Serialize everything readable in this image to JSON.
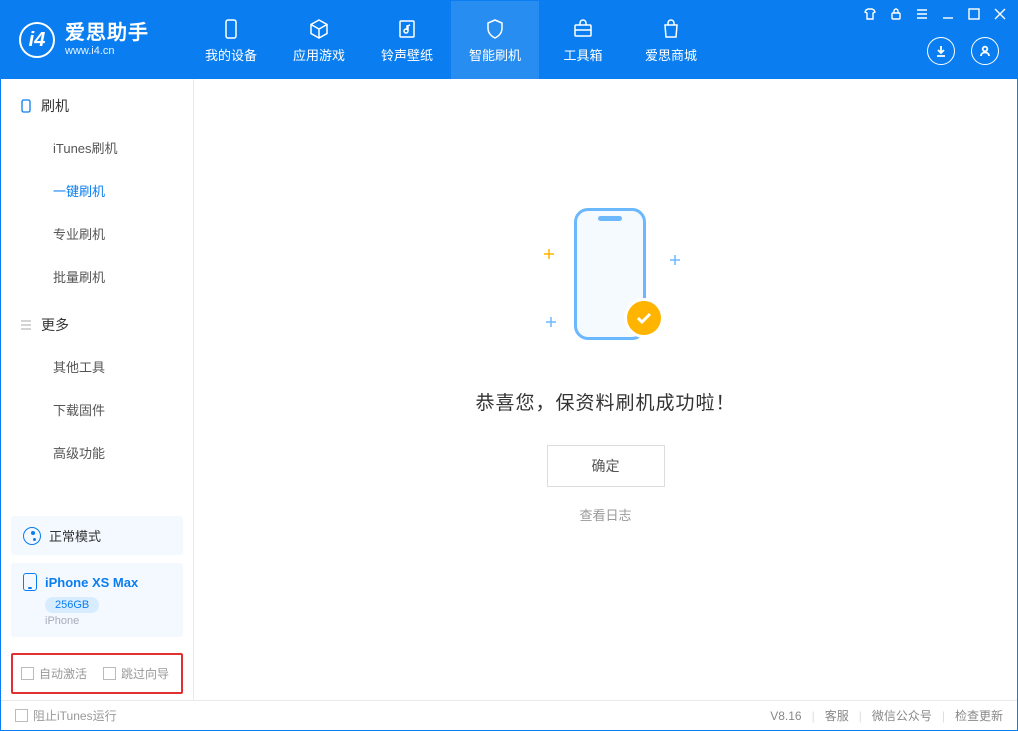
{
  "app": {
    "title": "爱思助手",
    "subtitle": "www.i4.cn"
  },
  "nav": {
    "tabs": [
      {
        "label": "我的设备"
      },
      {
        "label": "应用游戏"
      },
      {
        "label": "铃声壁纸"
      },
      {
        "label": "智能刷机"
      },
      {
        "label": "工具箱"
      },
      {
        "label": "爱思商城"
      }
    ]
  },
  "sidebar": {
    "sections": [
      {
        "title": "刷机",
        "items": [
          {
            "label": "iTunes刷机"
          },
          {
            "label": "一键刷机",
            "active": true
          },
          {
            "label": "专业刷机"
          },
          {
            "label": "批量刷机"
          }
        ]
      },
      {
        "title": "更多",
        "items": [
          {
            "label": "其他工具"
          },
          {
            "label": "下载固件"
          },
          {
            "label": "高级功能"
          }
        ]
      }
    ],
    "mode": {
      "label": "正常模式"
    },
    "device": {
      "name": "iPhone XS Max",
      "storage": "256GB",
      "type": "iPhone"
    },
    "checkboxes": {
      "auto_activate": "自动激活",
      "skip_guide": "跳过向导"
    }
  },
  "main": {
    "success_message": "恭喜您，保资料刷机成功啦！",
    "confirm_button": "确定",
    "view_log": "查看日志"
  },
  "footer": {
    "block_itunes": "阻止iTunes运行",
    "version": "V8.16",
    "links": {
      "support": "客服",
      "wechat": "微信公众号",
      "update": "检查更新"
    }
  }
}
